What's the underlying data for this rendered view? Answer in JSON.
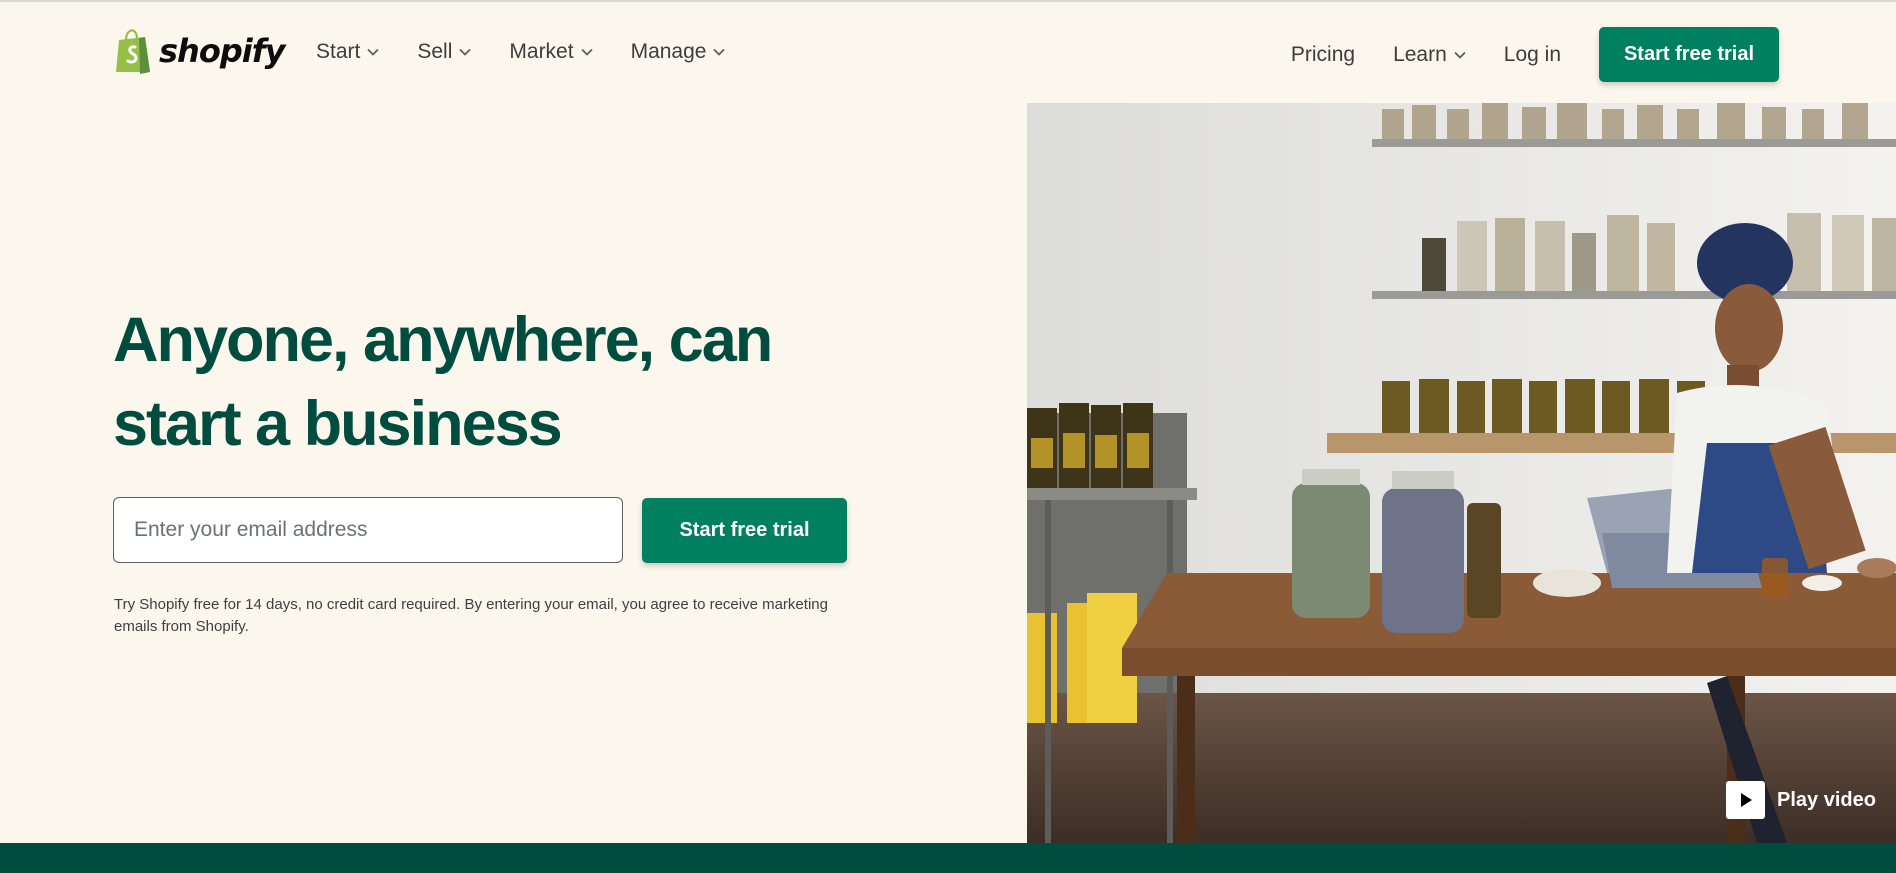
{
  "brand": {
    "name": "shopify",
    "logo_icon": "shopping-bag-icon",
    "logo_color": "#95bf47"
  },
  "nav": {
    "left": [
      {
        "label": "Start",
        "icon": "chevron-down-icon"
      },
      {
        "label": "Sell",
        "icon": "chevron-down-icon"
      },
      {
        "label": "Market",
        "icon": "chevron-down-icon"
      },
      {
        "label": "Manage",
        "icon": "chevron-down-icon"
      }
    ],
    "right": {
      "pricing": "Pricing",
      "learn": "Learn",
      "login": "Log in",
      "cta": "Start free trial"
    }
  },
  "hero": {
    "title_line1": "Anyone, anywhere, can",
    "title_line2": "start a business",
    "email_placeholder": "Enter your email address",
    "cta": "Start free trial",
    "disclaimer": "Try Shopify free for 14 days, no credit card required. By entering your email, you agree to receive marketing emails from Shopify.",
    "play_label": "Play video",
    "play_icon": "play-icon"
  },
  "colors": {
    "accent": "#008060",
    "heading": "#004c3f",
    "background": "#fbf7ed",
    "footer_band": "#004c3f"
  }
}
